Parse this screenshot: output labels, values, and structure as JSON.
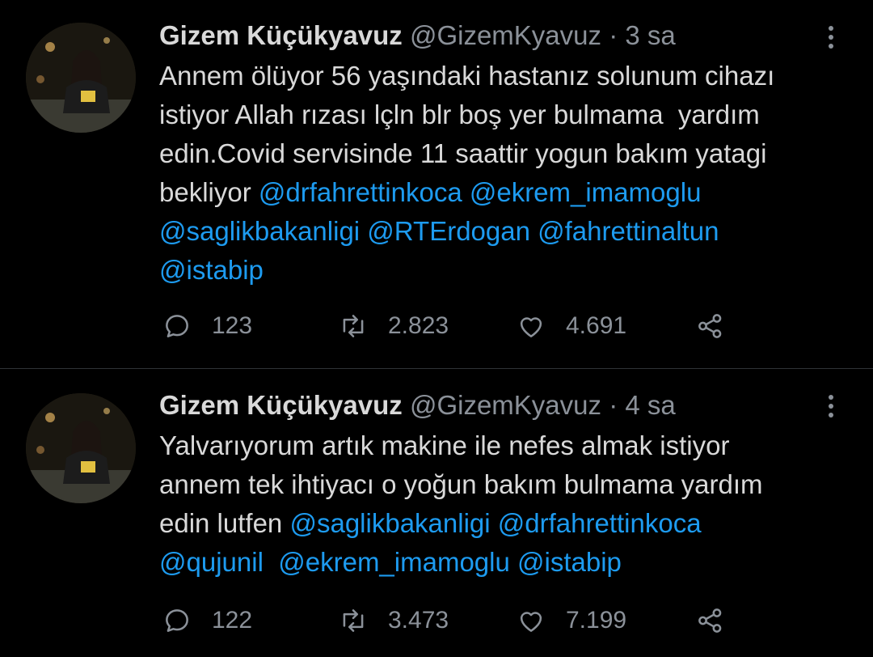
{
  "tweets": [
    {
      "name": "Gizem Küçükyavuz",
      "handle": "@GizemKyavuz",
      "dot": "·",
      "time": "3 sa",
      "lines": [
        [
          {
            "t": "Annem ölüyor 56 yaşındaki hastanız solunum cihazı"
          }
        ],
        [
          {
            "t": "istiyor Allah rızası lçln blr boş yer bulmama  yardım"
          }
        ],
        [
          {
            "t": "edin.Covid servisinde 11 saattir yogun bakım yatagi"
          }
        ],
        [
          {
            "t": "bekliyor "
          },
          {
            "t": "@drfahrettinkoca @ekrem_imamoglu",
            "m": true
          }
        ],
        [
          {
            "t": "@saglikbakanligi @RTErdogan @fahrettinaltun",
            "m": true
          }
        ],
        [
          {
            "t": "@istabip",
            "m": true
          }
        ]
      ],
      "replies": "123",
      "retweets": "2.823",
      "likes": "4.691"
    },
    {
      "name": "Gizem Küçükyavuz",
      "handle": "@GizemKyavuz",
      "dot": "·",
      "time": "4 sa",
      "lines": [
        [
          {
            "t": "Yalvarıyorum artık makine ile nefes almak istiyor"
          }
        ],
        [
          {
            "t": "annem tek ihtiyacı o yoğun bakım bulmama yardım"
          }
        ],
        [
          {
            "t": "edin lutfen "
          },
          {
            "t": "@saglikbakanligi @drfahrettinkoca",
            "m": true
          }
        ],
        [
          {
            "t": "@qujunil  @ekrem_imamoglu @istabip",
            "m": true
          }
        ]
      ],
      "replies": "122",
      "retweets": "3.473",
      "likes": "7.199"
    }
  ],
  "colors": {
    "background": "#000000",
    "text": "#d9d9d9",
    "muted": "#8b9199",
    "mention": "#1d9bf0"
  },
  "icons": [
    "reply-icon",
    "retweet-icon",
    "like-icon",
    "share-icon",
    "more-options-icon"
  ]
}
